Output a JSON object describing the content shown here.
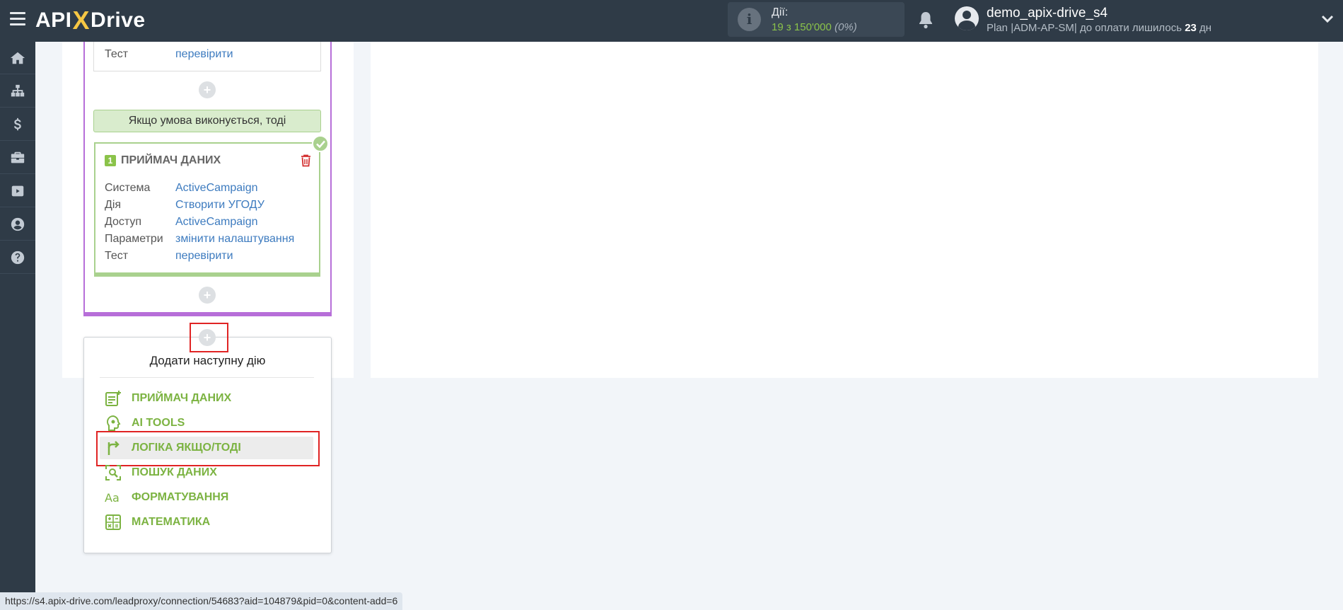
{
  "header": {
    "logo": {
      "left": "API",
      "x": "X",
      "right": "Drive"
    },
    "actions": {
      "title": "Дії:",
      "used": "19",
      "sep": "з",
      "total": "150'000",
      "pct": "(0%)"
    },
    "user": {
      "name": "demo_apix-drive_s4",
      "plan": "Plan |ADM-AP-SM| до оплати лишилось ",
      "days": "23",
      "days_unit": " дн"
    }
  },
  "sidebar": {
    "items": [
      "home-icon",
      "sitemap-icon",
      "dollar-icon",
      "briefcase-icon",
      "youtube-icon",
      "user-circle-icon",
      "question-icon"
    ]
  },
  "top_card": {
    "label": "Тест",
    "link": "перевірити"
  },
  "condition": {
    "text": "Якщо умова виконується, тоді"
  },
  "receiver": {
    "num": "1",
    "title": "ПРИЙМАЧ ДАНИХ",
    "rows": [
      {
        "label": "Система",
        "value": "ActiveCampaign"
      },
      {
        "label": "Дія",
        "value": "Створити УГОДУ"
      },
      {
        "label": "Доступ",
        "value": "ActiveCampaign"
      },
      {
        "label": "Параметри",
        "value": "змінити налаштування"
      },
      {
        "label": "Тест",
        "value": "перевірити"
      }
    ]
  },
  "plus": "+",
  "menu": {
    "title": "Додати наступну дію",
    "items": [
      {
        "label": "ПРИЙМАЧ ДАНИХ",
        "icon": "receiver-icon"
      },
      {
        "label": "AI TOOLS",
        "icon": "ai-icon"
      },
      {
        "label": "ЛОГІКА ЯКЩО/ТОДІ",
        "icon": "logic-icon"
      },
      {
        "label": "ПОШУК ДАНИХ",
        "icon": "search-data-icon"
      },
      {
        "label": "ФОРМАТУВАННЯ",
        "icon": "format-icon"
      },
      {
        "label": "МАТЕМАТИКА",
        "icon": "math-icon"
      }
    ]
  },
  "statusbar": {
    "url": "https://s4.apix-drive.com/leadproxy/connection/54683?aid=104879&pid=0&content-add=6"
  },
  "colors": {
    "header": "#2f3b47",
    "accent_green": "#7cb342",
    "purple": "#b76fd9",
    "link": "#3d7bbf",
    "highlight_red": "#e02424"
  }
}
